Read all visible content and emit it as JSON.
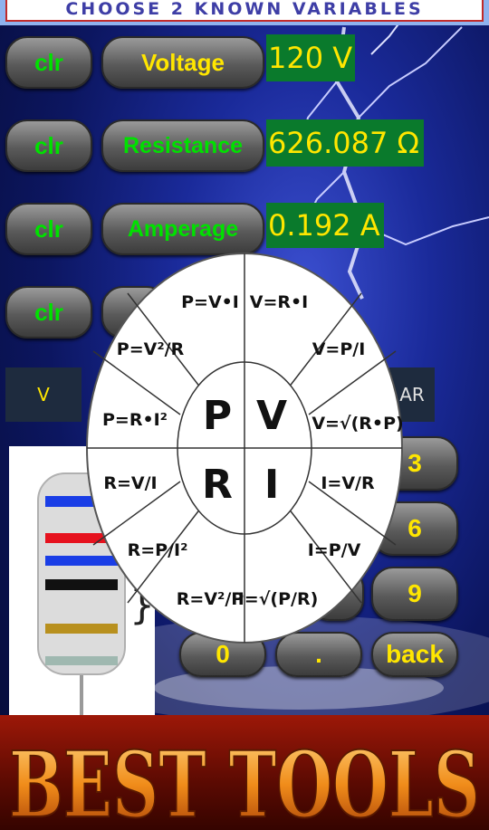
{
  "header": {
    "title": "CHOOSE 2 KNOWN VARIABLES"
  },
  "rows": [
    {
      "clr_label": "clr",
      "variable_label": "Voltage",
      "value": "120 V"
    },
    {
      "clr_label": "clr",
      "variable_label": "Resistance",
      "value": "626.087 Ω"
    },
    {
      "clr_label": "clr",
      "variable_label": "Amperage",
      "value": "0.192 A"
    },
    {
      "clr_label": "clr"
    }
  ],
  "input": {
    "value": "V",
    "right_label": "AR"
  },
  "keypad": {
    "k3": "3",
    "k6": "6",
    "k9": "9",
    "k0": "0",
    "dot": ".",
    "back": "back"
  },
  "wheel": {
    "center": {
      "p": "P",
      "v": "V",
      "r": "R",
      "i": "I"
    },
    "formulas": [
      "P=V•I",
      "V=R•I",
      "V=P/I",
      "V=√(R•P)",
      "I=V/R",
      "I=P/V",
      "I=√(P/R)",
      "R=V²/P",
      "R=P/I²",
      "R=V/I",
      "P=R•I²",
      "P=V²/R"
    ]
  },
  "logo": {
    "text": "BEST TOOLS"
  },
  "colors": {
    "button_text_green": "#00e100",
    "button_text_yellow": "#ffe600",
    "value_bg": "#0a7a2c",
    "value_text": "#ffe600"
  }
}
